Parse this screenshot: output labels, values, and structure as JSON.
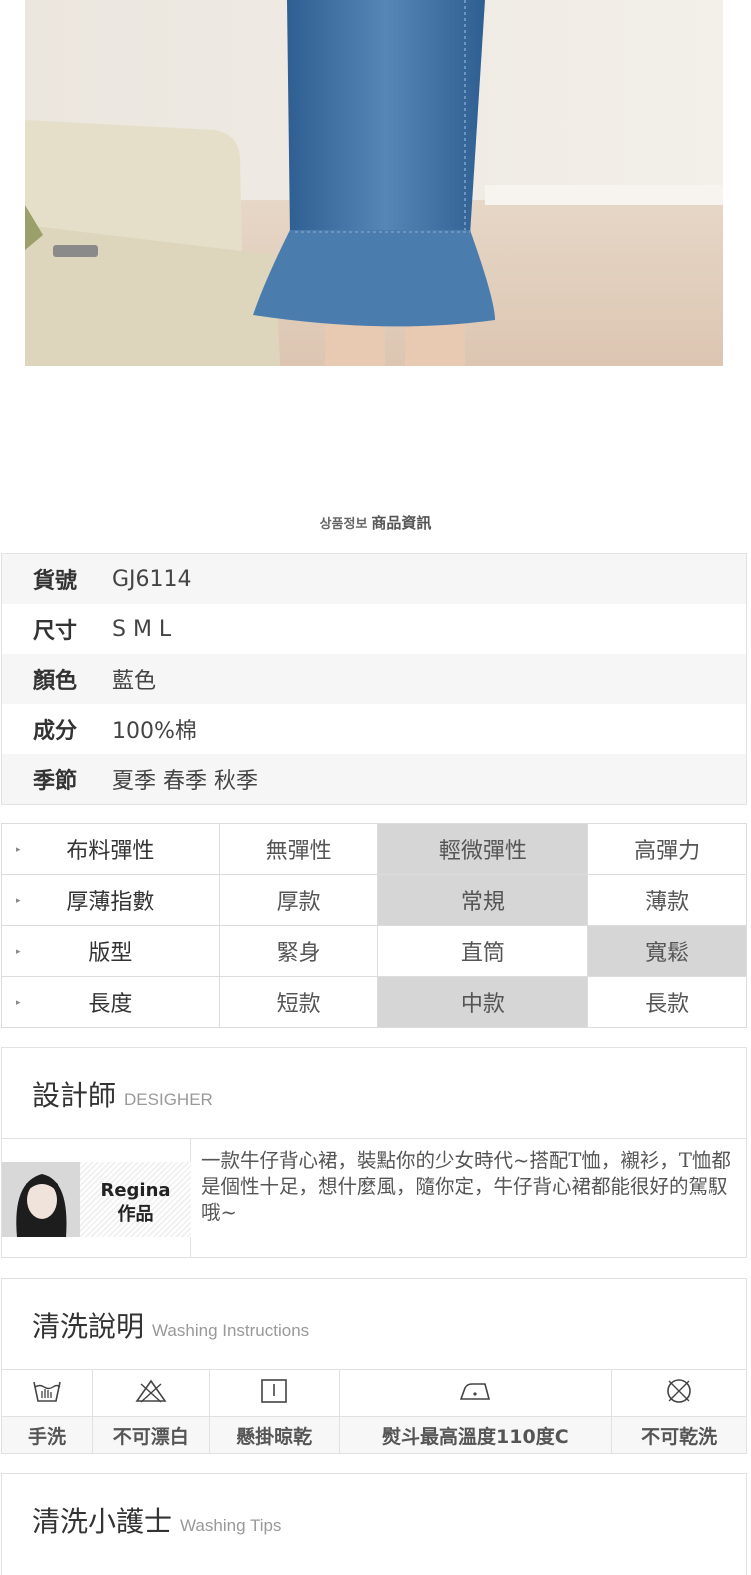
{
  "section_title": {
    "kr": "상품정보",
    "zh": "商品資訊"
  },
  "spec": [
    {
      "label": "貨號",
      "value": "GJ6114"
    },
    {
      "label": "尺寸",
      "value": "S M L"
    },
    {
      "label": "顏色",
      "value": "藍色"
    },
    {
      "label": "成分",
      "value": "100%棉"
    },
    {
      "label": "季節",
      "value": "夏季 春季 秋季"
    }
  ],
  "attributes": [
    {
      "label": "布料彈性",
      "options": [
        "無彈性",
        "輕微彈性",
        "高彈力"
      ],
      "selected": 1
    },
    {
      "label": "厚薄指數",
      "options": [
        "厚款",
        "常規",
        "薄款"
      ],
      "selected": 1
    },
    {
      "label": "版型",
      "options": [
        "緊身",
        "直筒",
        "寬鬆"
      ],
      "selected": 2
    },
    {
      "label": "長度",
      "options": [
        "短款",
        "中款",
        "長款"
      ],
      "selected": 1
    }
  ],
  "designer": {
    "title": "設計師",
    "subtitle": "DESIGHER",
    "name": "Regina",
    "name_suffix": "作品",
    "description": "一款牛仔背心裙，裝點你的少女時代~搭配T恤，襯衫，T恤都是個性十足，想什麼風，隨你定，牛仔背心裙都能很好的駕馭哦~"
  },
  "washing": {
    "title": "清洗說明",
    "subtitle": "Washing Instructions",
    "items": [
      {
        "icon": "hand-wash-icon",
        "label": "手洗"
      },
      {
        "icon": "no-bleach-icon",
        "label": "不可漂白"
      },
      {
        "icon": "hang-dry-icon",
        "label": "懸掛晾乾"
      },
      {
        "icon": "iron-icon",
        "label": "熨斗最高溫度110度C"
      },
      {
        "icon": "no-dry-clean-icon",
        "label": "不可乾洗"
      }
    ]
  },
  "tips": {
    "title": "清洗小護士",
    "subtitle": "Washing Tips"
  },
  "colors": {
    "highlight": "#d6d6d6",
    "border": "#e1e1e1",
    "denim": "#3f6f9e"
  }
}
